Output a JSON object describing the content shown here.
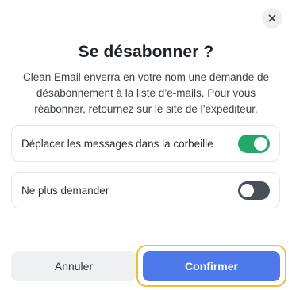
{
  "dialog": {
    "title": "Se désabonner ?",
    "description": "Clean Email enverra en votre nom une demande de désabonnement à la liste d’e-mails. Pour vous réabonner, retournez sur le site de l’expéditeur.",
    "close_icon": "close-icon"
  },
  "options": [
    {
      "label": "Déplacer les messages dans la corbeille",
      "enabled": true
    },
    {
      "label": "Ne plus demander",
      "enabled": false
    }
  ],
  "buttons": {
    "cancel_label": "Annuler",
    "confirm_label": "Confirmer"
  },
  "colors": {
    "toggle_on": "#23a869",
    "toggle_off": "#4a4e55",
    "confirm": "#4e79ea",
    "focus_ring": "#f0bc3a"
  }
}
